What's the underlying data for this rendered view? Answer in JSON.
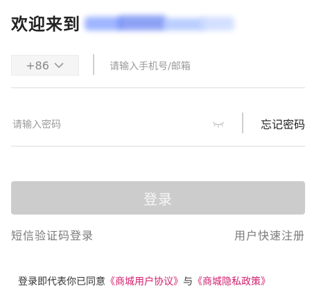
{
  "header": {
    "title_prefix": "欢迎来到"
  },
  "phone": {
    "country_code": "+86",
    "placeholder": "请输入手机号/邮箱"
  },
  "password": {
    "placeholder": "请输入密码",
    "forgot_label": "忘记密码"
  },
  "login_button": {
    "label": "登录"
  },
  "links": {
    "sms_login": "短信验证码登录",
    "quick_register": "用户快速注册"
  },
  "agreement": {
    "prefix": "登录即代表你已同意",
    "user_agreement": "《商城用户协议》",
    "conjunction": "与",
    "privacy_policy": "《商城隐私政策》"
  },
  "colors": {
    "button_disabled": "#cccccc",
    "link_accent": "#d11f6d",
    "text_primary": "#222222",
    "text_secondary": "#7a7a7a"
  },
  "icons": {
    "country_dropdown": "chevron-down-icon",
    "password_visibility": "eye-closed-icon"
  }
}
